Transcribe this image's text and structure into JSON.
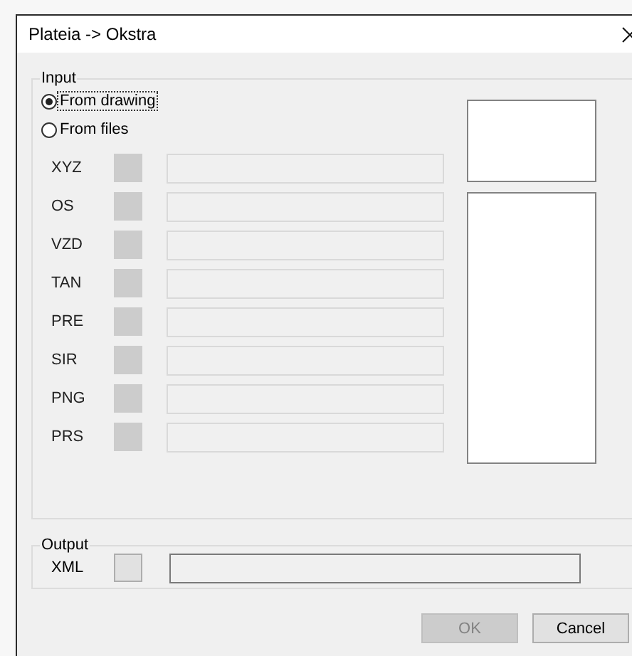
{
  "window": {
    "title": "Plateia -> Okstra"
  },
  "input": {
    "legend": "Input",
    "sources": [
      {
        "label": "From drawing",
        "selected": true,
        "focused": true
      },
      {
        "label": "From files",
        "selected": false,
        "focused": false
      }
    ],
    "rows": [
      {
        "label": "XYZ",
        "disabled": true
      },
      {
        "label": "OS",
        "disabled": true
      },
      {
        "label": "VZD",
        "disabled": true
      },
      {
        "label": "TAN",
        "disabled": true
      },
      {
        "label": "PRE",
        "disabled": true
      },
      {
        "label": "SIR",
        "disabled": true
      },
      {
        "label": "PNG",
        "disabled": true
      },
      {
        "label": "PRS",
        "disabled": true
      }
    ]
  },
  "output": {
    "legend": "Output",
    "rows": [
      {
        "label": "XML",
        "disabled": false
      }
    ]
  },
  "buttons": [
    {
      "label": "OK",
      "disabled": true
    },
    {
      "label": "Cancel",
      "disabled": false
    }
  ]
}
